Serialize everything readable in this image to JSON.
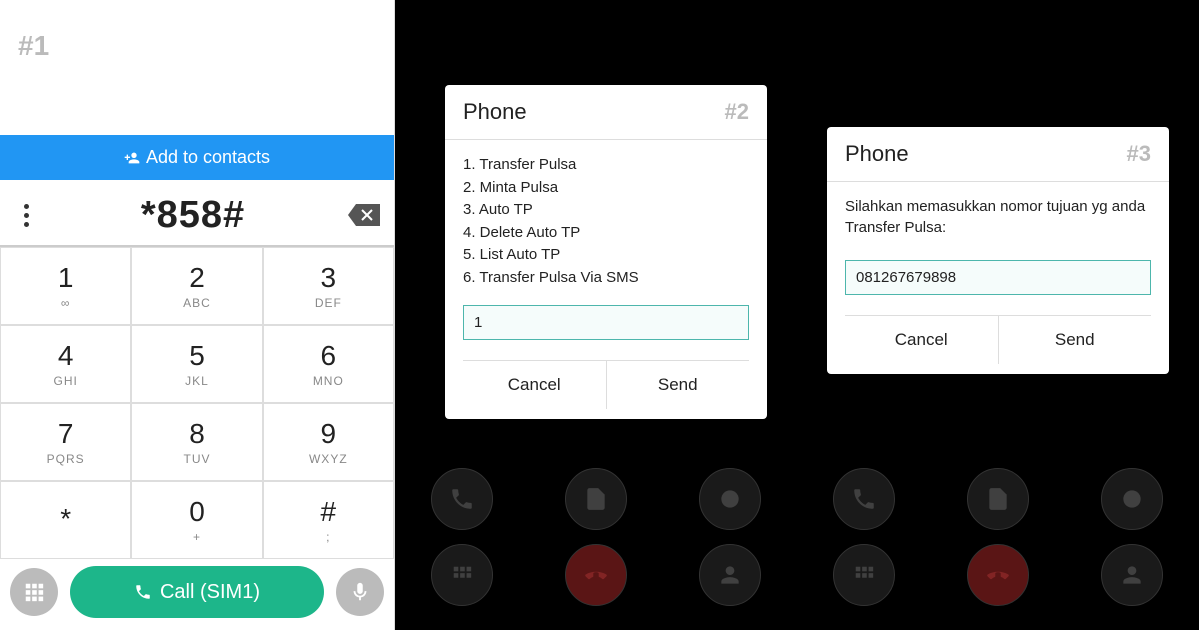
{
  "panel1": {
    "step": "#1",
    "add_contacts": "Add to contacts",
    "dialed": "*858#",
    "keys": [
      {
        "digit": "1",
        "letters": "∞"
      },
      {
        "digit": "2",
        "letters": "ABC"
      },
      {
        "digit": "3",
        "letters": "DEF"
      },
      {
        "digit": "4",
        "letters": "GHI"
      },
      {
        "digit": "5",
        "letters": "JKL"
      },
      {
        "digit": "6",
        "letters": "MNO"
      },
      {
        "digit": "7",
        "letters": "PQRS"
      },
      {
        "digit": "8",
        "letters": "TUV"
      },
      {
        "digit": "9",
        "letters": "WXYZ"
      },
      {
        "digit": "*",
        "letters": ""
      },
      {
        "digit": "0",
        "letters": "+"
      },
      {
        "digit": "#",
        "letters": ";"
      }
    ],
    "call_label": "Call (SIM1)"
  },
  "panel2": {
    "title": "Phone",
    "step": "#2",
    "menu": [
      "1. Transfer Pulsa",
      "2. Minta Pulsa",
      "3. Auto TP",
      "4. Delete Auto TP",
      "5. List Auto TP",
      "6. Transfer Pulsa Via SMS"
    ],
    "input_value": "1",
    "cancel": "Cancel",
    "send": "Send"
  },
  "panel3": {
    "title": "Phone",
    "step": "#3",
    "prompt": "Silahkan memasukkan nomor tujuan yg anda Transfer Pulsa:",
    "input_value": "081267679898",
    "cancel": "Cancel",
    "send": "Send"
  }
}
